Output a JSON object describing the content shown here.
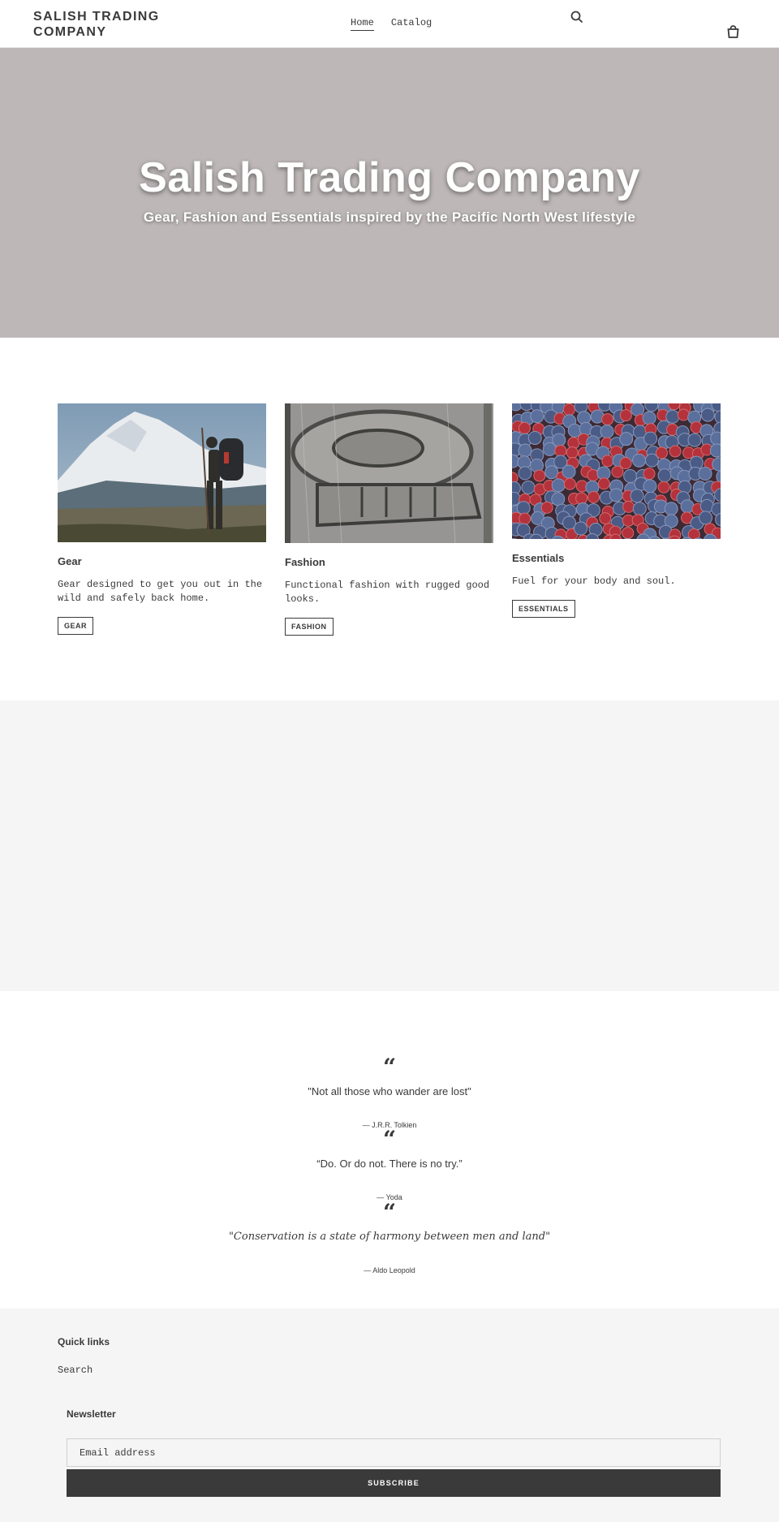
{
  "header": {
    "logo": "SALISH TRADING COMPANY",
    "nav": [
      {
        "label": "Home",
        "active": true
      },
      {
        "label": "Catalog",
        "active": false
      }
    ],
    "search_icon": "search-icon",
    "cart_icon": "cart-icon"
  },
  "hero": {
    "title": "Salish Trading Company",
    "subtitle": "Gear, Fashion and Essentials inspired by the Pacific North West lifestyle",
    "background_color": "#bdb7b7"
  },
  "collections": [
    {
      "title": "Gear",
      "description": "Gear designed to get you out in the wild and safely back home.",
      "button": "GEAR"
    },
    {
      "title": "Fashion",
      "description": "Functional fashion with rugged good looks.",
      "button": "FASHION"
    },
    {
      "title": "Essentials",
      "description": "Fuel for your body and soul.",
      "button": "ESSENTIALS"
    }
  ],
  "quotes": [
    {
      "text": "\"Not all those who wander are lost\"",
      "author": "— J.R.R. Tolkien"
    },
    {
      "text": "“Do. Or do not. There is no try.”",
      "author": "— Yoda"
    },
    {
      "text": "\"Conservation is a state of harmony between men and land\"",
      "author": "— Aldo Leopold"
    }
  ],
  "footer": {
    "quick_links_title": "Quick links",
    "quick_links": [
      "Search"
    ],
    "newsletter_title": "Newsletter",
    "email_placeholder": "Email address",
    "subscribe_label": "SUBSCRIBE"
  },
  "colors": {
    "text": "#3a3a3a",
    "footer_bg": "#f5f5f5",
    "button_bg": "#3a3a3a"
  }
}
